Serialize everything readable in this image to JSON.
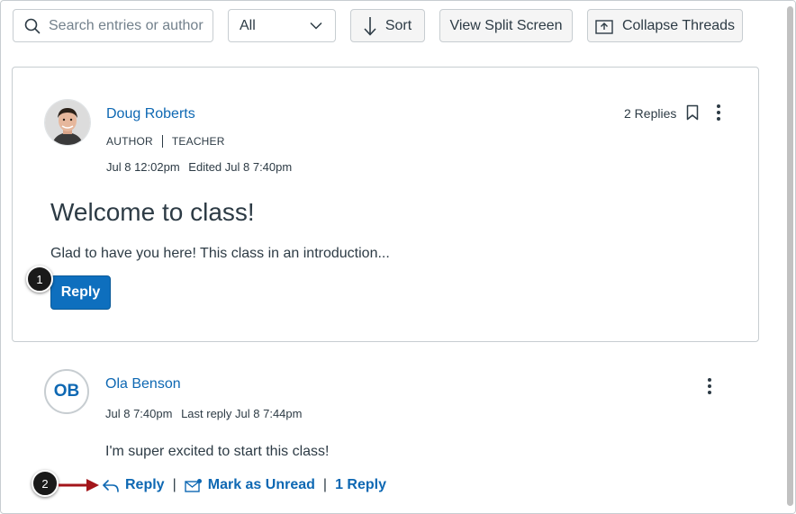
{
  "toolbar": {
    "search_placeholder": "Search entries or author",
    "filter_selected": "All",
    "sort_label": "Sort",
    "split_label": "View Split Screen",
    "collapse_label": "Collapse Threads"
  },
  "topic": {
    "author_name": "Doug Roberts",
    "role_author": "AUTHOR",
    "role_teacher": "TEACHER",
    "posted": "Jul 8 12:02pm",
    "edited": "Edited Jul 8 7:40pm",
    "replies_count": "2 Replies",
    "title": "Welcome to class!",
    "body": "Glad to have you here! This class in an introduction...",
    "reply_label": "Reply"
  },
  "reply_entry": {
    "initials": "OB",
    "author_name": "Ola Benson",
    "posted": "Jul 8 7:40pm",
    "last_reply": "Last reply Jul 8 7:44pm",
    "body": "I'm super excited to start this class!",
    "reply_label": "Reply",
    "mark_unread_label": "Mark as Unread",
    "replies_label": "1 Reply"
  },
  "callouts": [
    "1",
    "2"
  ],
  "colors": {
    "link_blue": "#0e68b3",
    "button_blue": "#0e6fbe",
    "text_dark": "#2d3b45",
    "arrow_red": "#a3151a"
  },
  "icons": [
    "search-icon",
    "chevron-down-icon",
    "arrow-down-icon",
    "collapse-icon",
    "bookmark-icon",
    "more-vertical-icon",
    "reply-icon",
    "mail-icon"
  ]
}
